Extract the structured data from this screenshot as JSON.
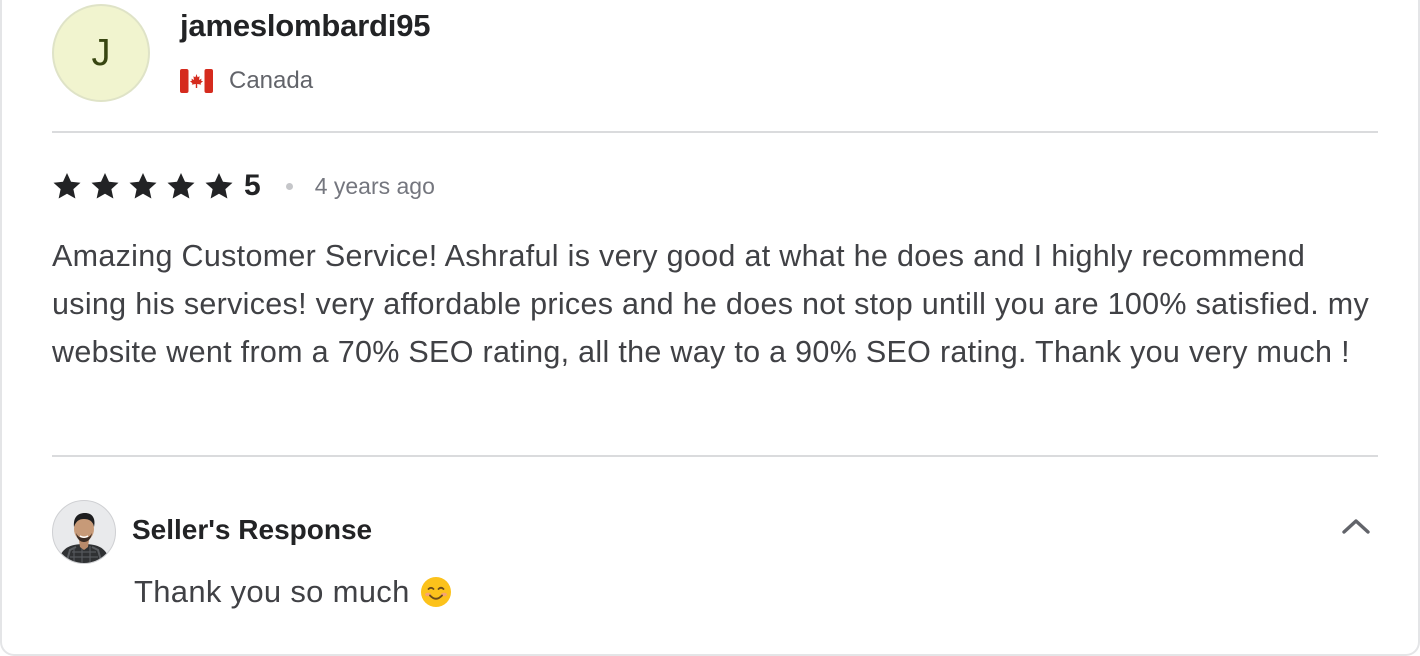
{
  "reviewer": {
    "initial": "J",
    "username": "jameslombardi95",
    "country": "Canada",
    "flag_icon": "canada-flag-icon"
  },
  "review": {
    "rating": "5",
    "stars": 5,
    "star_color": "#222325",
    "time_ago": "4 years ago",
    "text": "Amazing Customer Service! Ashraful is very good at what he does and I highly recommend using his services! very affordable prices and he does not stop untill you are 100% satisfied. my website went from a 70% SEO rating, all the way to a 90% SEO rating. Thank you very much !"
  },
  "seller_response": {
    "title": "Seller's Response",
    "text": "Thank you so much",
    "emoji_icon": "smiling-face-icon",
    "toggle_icon": "chevron-up-icon"
  },
  "colors": {
    "avatar_bg": "#f1f4cf",
    "avatar_text": "#384611",
    "divider": "#dadbdd",
    "muted_text": "#74767e"
  }
}
